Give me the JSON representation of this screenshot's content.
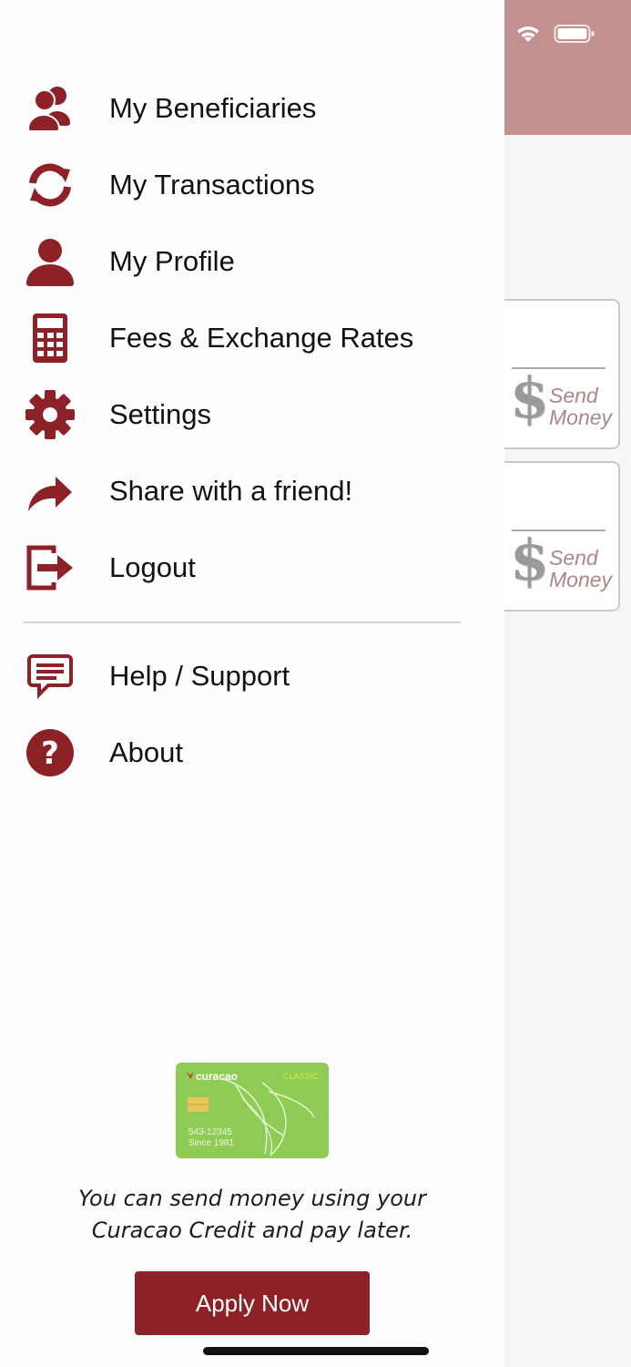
{
  "background": {
    "cards": [
      {
        "currency_symbol": "$",
        "send_label_line1": "Send",
        "send_label_line2": "Money"
      },
      {
        "currency_symbol": "$",
        "send_label_line1": "Send",
        "send_label_line2": "Money"
      }
    ]
  },
  "menu": {
    "items": [
      {
        "label": "My Beneficiaries",
        "icon": "users-icon"
      },
      {
        "label": "My Transactions",
        "icon": "refresh-icon"
      },
      {
        "label": "My Profile",
        "icon": "user-icon"
      },
      {
        "label": "Fees & Exchange Rates",
        "icon": "calculator-icon"
      },
      {
        "label": "Settings",
        "icon": "gear-icon"
      },
      {
        "label": "Share with a friend!",
        "icon": "share-icon"
      },
      {
        "label": "Logout",
        "icon": "logout-icon"
      }
    ],
    "secondary_items": [
      {
        "label": "Help / Support",
        "icon": "chat-icon"
      },
      {
        "label": "About",
        "icon": "question-icon"
      }
    ]
  },
  "promo": {
    "card": {
      "brand": "curacao",
      "tier": "CLASSIC",
      "number": "543-12345",
      "since": "Since 1981"
    },
    "text_line1": "You can send money using your",
    "text_line2": "Curacao Credit and pay later.",
    "button_label": "Apply Now"
  },
  "colors": {
    "accent": "#8c2128",
    "header_bg": "#c29090",
    "card_green": "#8fcc55"
  }
}
